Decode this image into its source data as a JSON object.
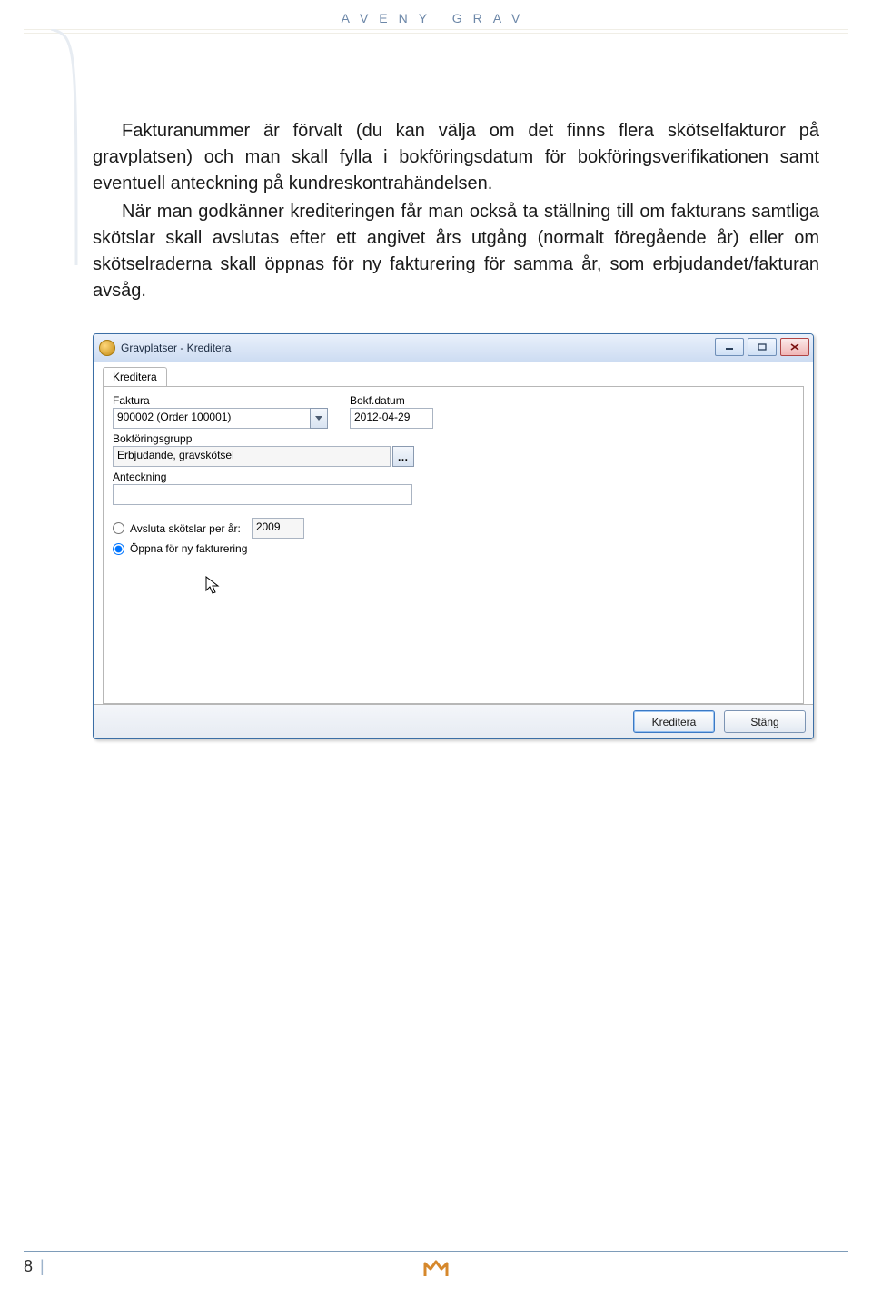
{
  "doc": {
    "running_head": "AVENY GRAV",
    "paragraph1": "Fakturanummer är förvalt (du kan välja om det finns flera skötselfakturor på gravplatsen) och man skall fylla i bokföringsdatum för bokföringsverifikationen samt eventuell anteckning på kundreskontrahändelsen.",
    "paragraph2": "När man godkänner krediteringen får man också ta ställning till om fakturans samtliga skötslar skall avslutas efter ett angivet års utgång (normalt föregående år) eller om skötselraderna skall öppnas för ny fakturering för samma år, som erbjudandet/fakturan avsåg.",
    "page_number": "8"
  },
  "win": {
    "title": "Gravplatser - Kreditera",
    "tab": "Kreditera",
    "fields": {
      "faktura": {
        "label": "Faktura",
        "value": "900002 (Order 100001)"
      },
      "bokfdatum": {
        "label": "Bokf.datum",
        "value": "2012-04-29"
      },
      "bokforingsgrupp": {
        "label": "Bokföringsgrupp",
        "value": "Erbjudande, gravskötsel"
      },
      "anteckning": {
        "label": "Anteckning",
        "value": ""
      }
    },
    "radios": {
      "avsluta": {
        "label": "Avsluta skötslar per år:",
        "year": "2009"
      },
      "oppna": {
        "label": "Öppna för ny fakturering"
      }
    },
    "buttons": {
      "kreditera": "Kreditera",
      "stang": "Stäng"
    }
  }
}
